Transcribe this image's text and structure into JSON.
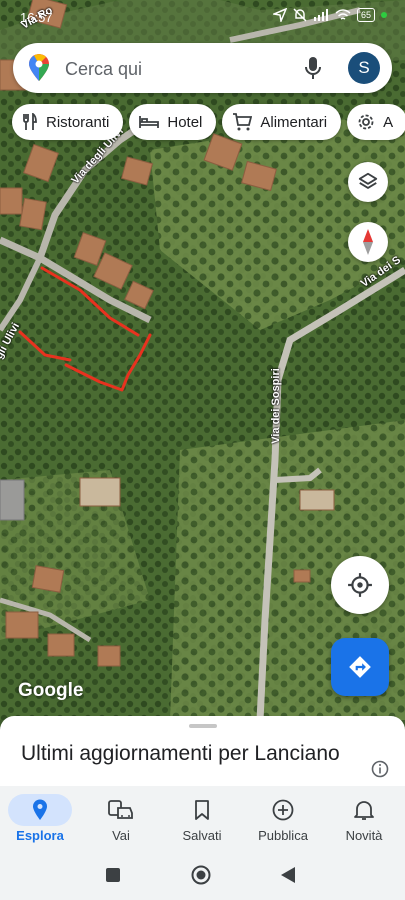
{
  "status": {
    "time": "16:57",
    "battery": "65"
  },
  "search": {
    "placeholder": "Cerca qui",
    "avatar_letter": "S"
  },
  "chips": [
    {
      "label": "Ristoranti",
      "icon": "cutlery-icon"
    },
    {
      "label": "Hotel",
      "icon": "bed-icon"
    },
    {
      "label": "Alimentari",
      "icon": "cart-icon"
    },
    {
      "label": "A",
      "icon": "gear-icon"
    }
  ],
  "map": {
    "roads": [
      "Via Ro",
      "Via degli Ulivi",
      "gli Ulivi",
      "Via dei Sospiri",
      "Via dei S"
    ],
    "logo": "Google",
    "compass_letter": "N"
  },
  "sheet": {
    "title": "Ultimi aggiornamenti per Lanciano"
  },
  "nav": [
    {
      "label": "Esplora",
      "icon": "explore-pin-icon",
      "active": true
    },
    {
      "label": "Vai",
      "icon": "commute-icon",
      "active": false
    },
    {
      "label": "Salvati",
      "icon": "bookmark-icon",
      "active": false
    },
    {
      "label": "Pubblica",
      "icon": "add-circle-icon",
      "active": false
    },
    {
      "label": "Novità",
      "icon": "bell-icon",
      "active": false
    }
  ],
  "colors": {
    "accent": "#1a73e8",
    "drawn_outline": "#e8321f"
  }
}
